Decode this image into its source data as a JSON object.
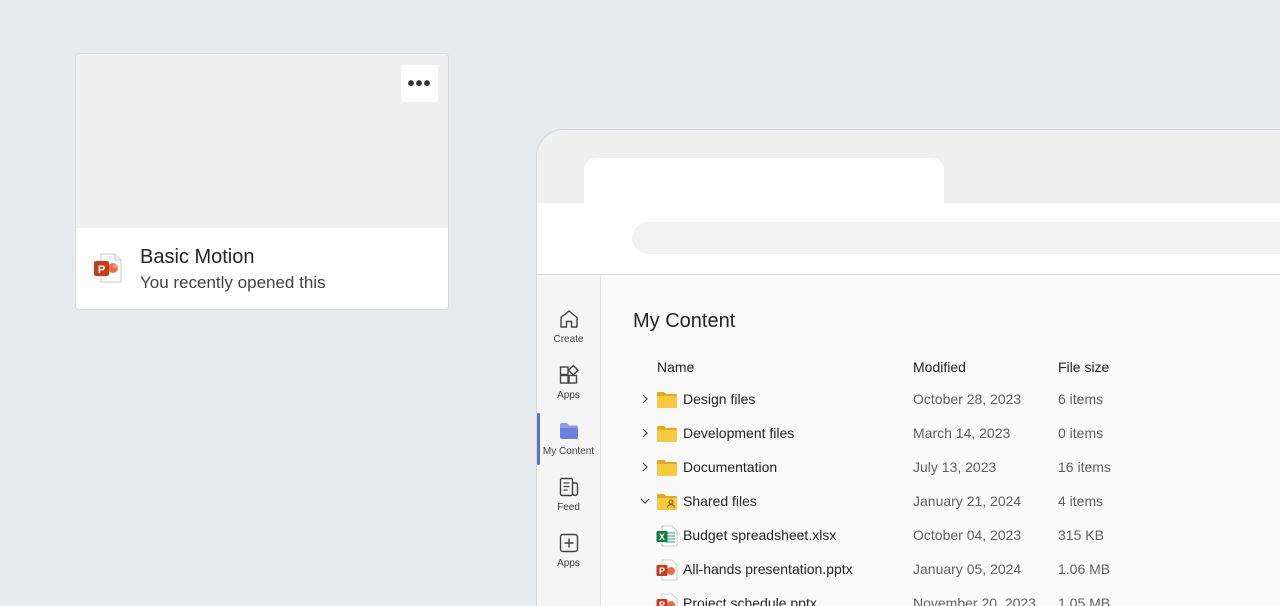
{
  "recent_card": {
    "title": "Basic Motion",
    "subtitle": "You recently opened this",
    "more_label": "•••",
    "file_icon": "powerpoint-icon"
  },
  "rail": {
    "items": [
      {
        "label": "Create",
        "icon": "home-icon"
      },
      {
        "label": "Apps",
        "icon": "apps-grid-icon"
      },
      {
        "label": "My Content",
        "icon": "folder-icon",
        "active": true
      },
      {
        "label": "Feed",
        "icon": "feed-icon"
      },
      {
        "label": "Apps",
        "icon": "add-square-icon"
      }
    ]
  },
  "content": {
    "title": "My Content",
    "columns": {
      "name": "Name",
      "modified": "Modified",
      "size": "File size"
    },
    "rows": [
      {
        "name": "Design files",
        "modified": "October 28, 2023",
        "size": "6 items",
        "type": "folder",
        "expander": "collapsed"
      },
      {
        "name": "Development files",
        "modified": "March 14, 2023",
        "size": "0 items",
        "type": "folder",
        "expander": "collapsed"
      },
      {
        "name": "Documentation",
        "modified": "July 13, 2023",
        "size": "16 items",
        "type": "folder",
        "expander": "collapsed"
      },
      {
        "name": "Shared files",
        "modified": "January 21, 2024",
        "size": "4 items",
        "type": "shared-folder",
        "expander": "expanded"
      },
      {
        "name": "Budget spreadsheet.xlsx",
        "modified": "October 04, 2023",
        "size": "315 KB",
        "type": "excel"
      },
      {
        "name": "All-hands presentation.pptx",
        "modified": "January 05, 2024",
        "size": "1.06 MB",
        "type": "powerpoint"
      },
      {
        "name": "Project schedule.pptx",
        "modified": "November 20, 2023",
        "size": "1.05 MB",
        "type": "powerpoint"
      }
    ]
  },
  "colors": {
    "background": "#e8ebee",
    "accent": "#5b6dd6",
    "folder": "#f5c542",
    "powerpoint": "#c43e1c",
    "excel": "#107c41"
  }
}
